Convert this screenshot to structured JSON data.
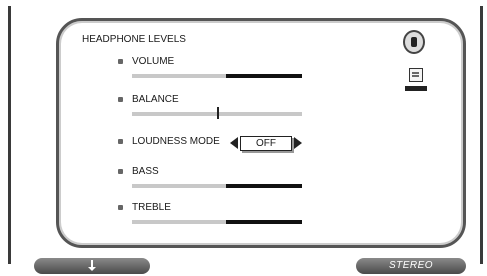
{
  "menu": {
    "title": "HEADPHONE LEVELS"
  },
  "settings": [
    {
      "label": "VOLUME",
      "level": 0.55
    },
    {
      "label": "BALANCE",
      "level": 0.5
    },
    {
      "label": "LOUDNESS MODE",
      "value": "OFF"
    },
    {
      "label": "BASS",
      "level": 0.55
    },
    {
      "label": "TREBLE",
      "level": 0.55
    }
  ],
  "footer": {
    "right_label": "STEREO"
  },
  "icons": [
    "speaker-icon",
    "document-icon",
    "down-arrow-icon",
    "left-arrow-icon",
    "right-arrow-icon"
  ]
}
